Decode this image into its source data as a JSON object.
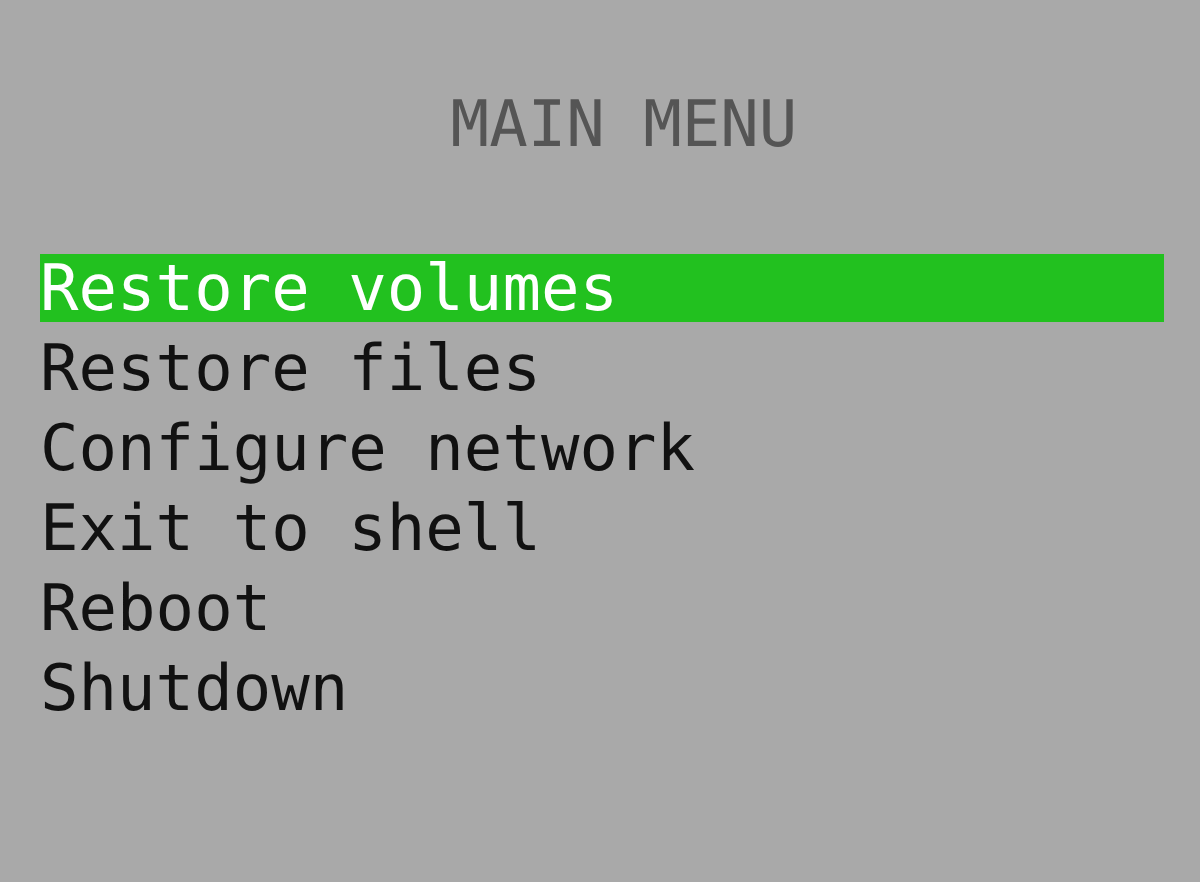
{
  "title": "MAIN MENU",
  "menu_items": [
    {
      "label": "Restore volumes",
      "selected": true
    },
    {
      "label": "Restore files",
      "selected": false
    },
    {
      "label": "Configure network",
      "selected": false
    },
    {
      "label": "Exit to shell",
      "selected": false
    },
    {
      "label": "Reboot",
      "selected": false
    },
    {
      "label": "Shutdown",
      "selected": false
    }
  ]
}
